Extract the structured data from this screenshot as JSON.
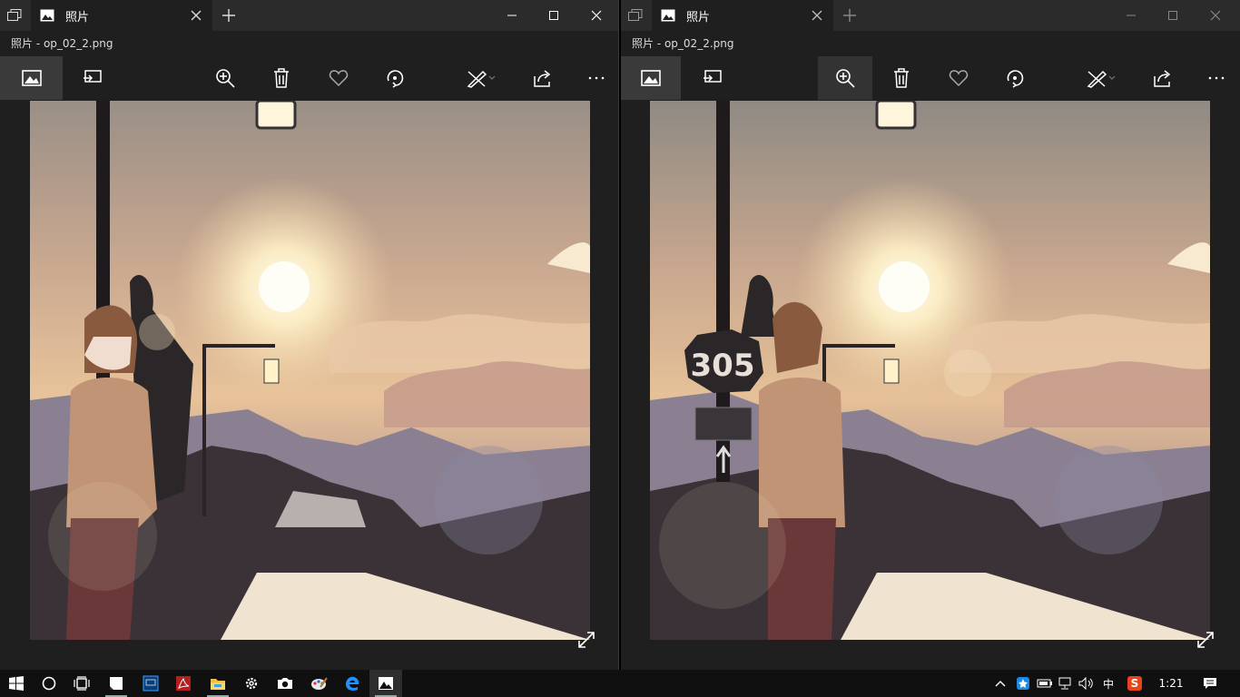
{
  "windows": [
    {
      "tab_title": "照片",
      "file_name": "照片 - op_02_2.png",
      "toolbar": {
        "selected": "view-photo",
        "hovered": ""
      }
    },
    {
      "tab_title": "照片",
      "file_name": "照片 - op_02_2.png",
      "toolbar": {
        "selected": "view-photo",
        "hovered": "zoom"
      },
      "sign_text": "305"
    }
  ],
  "toolbar_icons": [
    "view-photo-icon",
    "slideshow-icon",
    "zoom-in-icon",
    "delete-icon",
    "heart-icon",
    "rotate-icon",
    "edit-draw-icon",
    "share-icon",
    "more-icon"
  ],
  "taskbar": {
    "apps": [
      "windows-start-icon",
      "cortana-search-icon",
      "task-view-icon",
      "sticky-notes-icon",
      "ps-app-icon",
      "pdf-reader-icon",
      "file-explorer-icon",
      "settings-gear-icon",
      "camera-icon",
      "paint-icon",
      "edge-browser-icon",
      "photos-app-icon"
    ],
    "ime": "中",
    "ime_app": "S",
    "clock": "1:21"
  },
  "colors": {
    "titlebar": "#2b2b2b",
    "window_bg": "#1f1f1f",
    "taskbar": "#101010",
    "active_button": "#3a3a3a"
  }
}
